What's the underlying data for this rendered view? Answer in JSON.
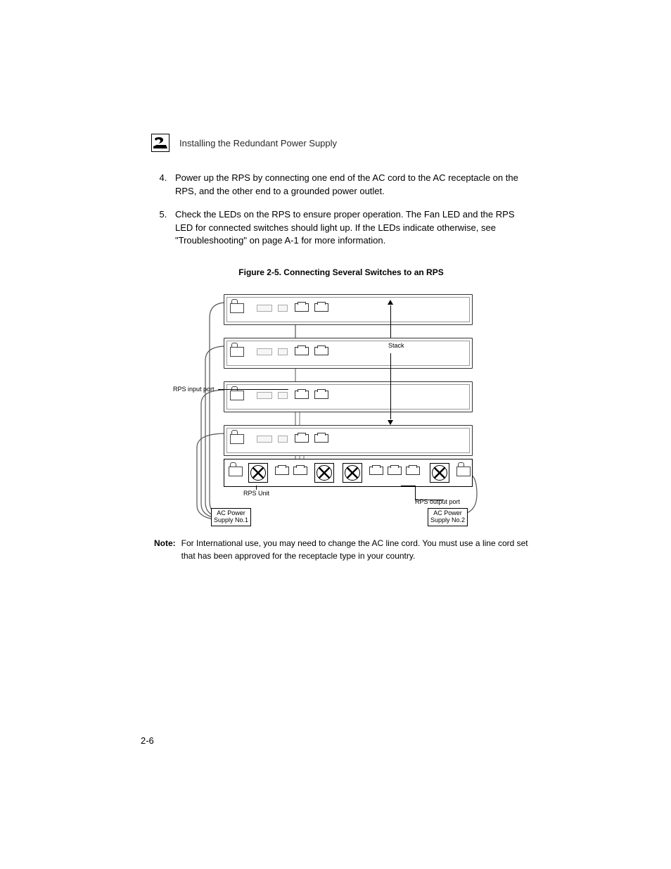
{
  "header": {
    "chapter_number": "2",
    "section_title": "Installing the Redundant Power Supply"
  },
  "steps": {
    "start": 4,
    "items": [
      "Power up the RPS by connecting one end of the AC cord to the AC receptacle on the RPS, and the other end to a grounded power outlet.",
      "Check the LEDs on the RPS to ensure proper operation. The Fan LED and the RPS LED for connected switches should light up. If the LEDs indicate otherwise, see \"Troubleshooting\" on page A-1 for more information."
    ]
  },
  "figure": {
    "caption": "Figure 2-5.  Connecting Several Switches to an RPS",
    "labels": {
      "stack": "Stack",
      "rps_input_port": "RPS input port",
      "rps_unit": "RPS Unit",
      "rps_output_port": "RPS output port",
      "ac_power_1": "AC Power\nSupply No.1",
      "ac_power_2": "AC Power\nSupply No.2"
    }
  },
  "note": {
    "label": "Note:",
    "text": "For International use, you may need to change the AC line cord. You must use a line cord set that has been approved for the receptacle type in your country."
  },
  "page_number": "2-6"
}
